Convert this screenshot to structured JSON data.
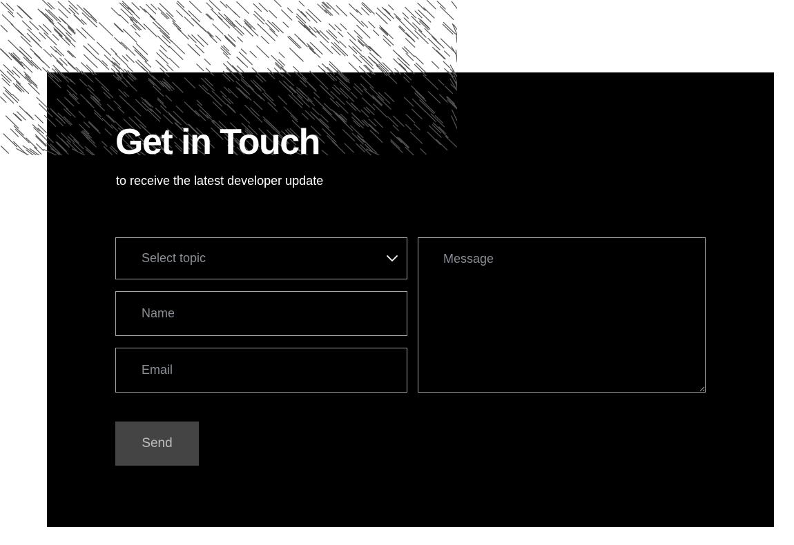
{
  "heading": {
    "title": "Get in Touch",
    "subtitle": "to receive the latest developer update"
  },
  "form": {
    "topic": {
      "placeholder": "Select topic",
      "icon": "chevron-down-icon"
    },
    "name": {
      "placeholder": "Name"
    },
    "email": {
      "placeholder": "Email"
    },
    "message": {
      "placeholder": "Message"
    },
    "send_label": "Send"
  },
  "colors": {
    "panel_background": "#000000",
    "page_background": "#ffffff",
    "field_border": "#a6a6a6",
    "placeholder_text": "#8a8f98",
    "button_background": "#444444",
    "button_text": "#bdbdbd",
    "hatch_stroke": "#555555"
  }
}
